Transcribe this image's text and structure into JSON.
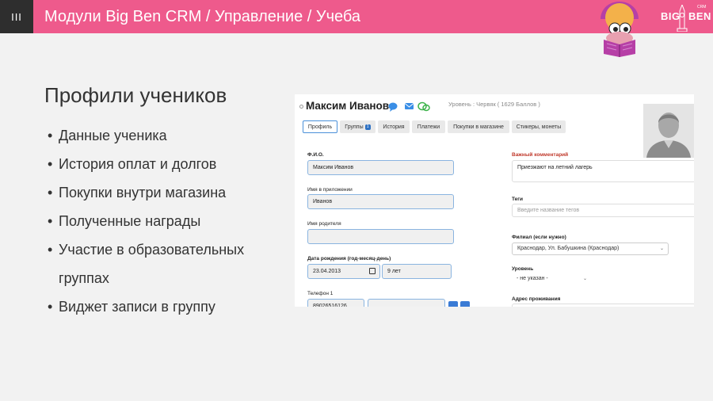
{
  "header": {
    "slide_number": "III",
    "title": "Модули Big Ben CRM / Управление / Учеба",
    "logo_big": "BIG",
    "logo_ben": "BEN",
    "logo_crm": "CRM"
  },
  "slide": {
    "heading": "Профили учеников",
    "bullets": [
      "Данные ученика",
      "История оплат и долгов",
      "Покупки внутри магазина",
      "Полученные награды",
      "Участие в образовательных группах",
      "Виджет записи в группу"
    ]
  },
  "screenshot": {
    "student_name": "Максим Иванов",
    "level_info": "Уровень : Червяк ( 1629 Баллов )",
    "tabs": [
      {
        "label": "Профиль",
        "badge": ""
      },
      {
        "label": "Группы",
        "badge": "1"
      },
      {
        "label": "История",
        "badge": ""
      },
      {
        "label": "Платежи",
        "badge": ""
      },
      {
        "label": "Покупки в магазине",
        "badge": ""
      },
      {
        "label": "Стикеры, монеты",
        "badge": ""
      }
    ],
    "form": {
      "fio_label": "Ф.И.О.",
      "fio_value": "Максим Иванов",
      "app_name_label": "Имя в приложении",
      "app_name_value": "Иванов",
      "parent_name_label": "Имя родителя",
      "parent_name_value": "",
      "birth_label": "Дата рождения (год-месяц-день)",
      "birth_value": "23.04.2013",
      "age_value": "9 лет",
      "phone_label": "Телефон 1",
      "phone_value": "89026516126",
      "comment_label": "Важный комментарий",
      "comment_value": "Приезжают на летний лагерь",
      "tags_label": "Теги",
      "tags_placeholder": "Введите название тегов",
      "branch_label": "Филиал (если нужно)",
      "branch_value": "Краснодар, Ул. Бабушкина (Краснодар)",
      "level_label": "Уровень",
      "level_value": "- не указан -",
      "address_label": "Адрес проживания"
    }
  },
  "colors": {
    "header_bg": "#ee5a8c",
    "accent_blue": "#3a7bd5",
    "important_red": "#c0392b"
  }
}
